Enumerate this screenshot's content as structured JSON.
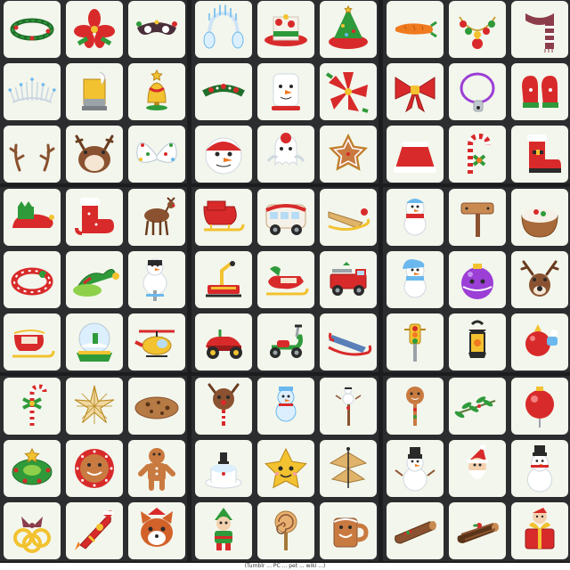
{
  "footer": {
    "caption": "(Tumblr ... PC ... pet ... wiki ...)"
  },
  "colors": {
    "page_background": "#1b1d1e",
    "panel_background": "#2b2d2f",
    "tile_background": "#f3f6ec"
  },
  "panels": [
    {
      "items": [
        "holly-halo-icon",
        "poinsettia-icon",
        "winter-mask-icon",
        "ice-crown-icon",
        "nutcracker-hat-icon",
        "christmas-bell-icon",
        "reindeer-antlers-icon",
        "reindeer-hood-icon",
        "snowflake-wings-icon"
      ]
    },
    {
      "items": [
        "ice-headphones-icon",
        "candy-hat-icon",
        "christmas-tree-hat-icon",
        "holly-garland-icon",
        "snowman-hat-icon",
        "poinsettia-flower-icon",
        "snowman-mask-icon",
        "snow-ghost-icon",
        "gingerbread-star-icon"
      ]
    },
    {
      "items": [
        "carrot-nose-icon",
        "ornament-necklace-icon",
        "striped-scarf-icon",
        "red-bow-icon",
        "whistle-necklace-icon",
        "mittens-icon",
        "santa-skirt-icon",
        "candy-cane-icon",
        "santa-boot-icon"
      ]
    },
    {
      "items": [
        "elf-shoes-icon",
        "stocking-shoes-icon",
        "reindeer-stroller-icon",
        "candy-ring-icon",
        "elf-hat-icon",
        "snowman-pogo-icon",
        "sleigh-stroller-icon",
        "snow-globe-icon",
        "helicopter-icon"
      ]
    },
    {
      "items": [
        "sleigh-icon",
        "gingerbread-bus-icon",
        "wooden-sled-icon",
        "sled-cart-icon",
        "toboggan-icon",
        "fire-truck-icon",
        "toy-car-icon",
        "scooter-icon",
        "snow-sled-icon"
      ]
    },
    {
      "items": [
        "snowman-plush-icon",
        "wooden-sign-icon",
        "pudding-bowl-icon",
        "snowman-pet-icon",
        "ornament-pet-icon",
        "reindeer-pet-icon",
        "traffic-light-icon",
        "lantern-icon",
        "toy-ornament-icon"
      ]
    },
    {
      "items": [
        "candy-cane-stick-icon",
        "gold-star-icon",
        "cookie-icon",
        "wreath-icon",
        "gingerbread-clock-icon",
        "gingerbread-man-icon",
        "gold-rings-icon",
        "rocket-gift-icon",
        "red-panda-icon"
      ]
    },
    {
      "items": [
        "reindeer-rattle-icon",
        "snowman-balloon-icon",
        "snowman-stick-icon",
        "snow-cake-icon",
        "star-plush-icon",
        "chime-icon",
        "elf-doll-icon",
        "lollipop-icon",
        "gingerbread-mug-icon"
      ]
    },
    {
      "items": [
        "gingerbread-stick-icon",
        "holly-sprig-icon",
        "red-ornament-icon",
        "snowman-figure-icon",
        "santa-doll-icon",
        "snowman-figurine-icon",
        "yule-log-icon",
        "log-cake-icon",
        "santa-present-icon"
      ]
    }
  ]
}
